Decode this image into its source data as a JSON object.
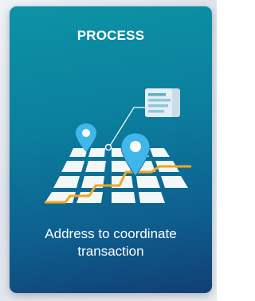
{
  "card": {
    "title": "PROCESS",
    "caption": "Address to coordinate transaction",
    "illustration": "map-location-pin-icon",
    "colors": {
      "gradient_top": "#0d93a5",
      "gradient_bottom": "#113f74",
      "route": "#f2a71b",
      "pin": "#3fb7ea"
    }
  }
}
